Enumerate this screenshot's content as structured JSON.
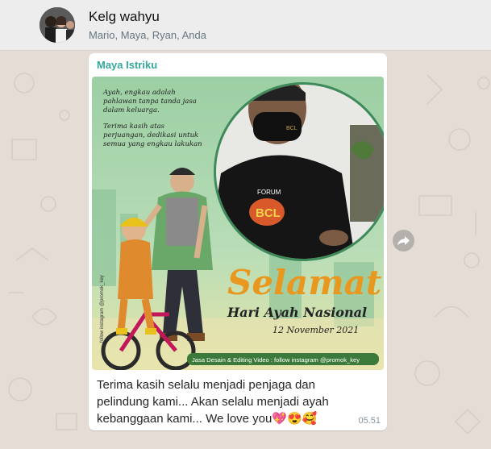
{
  "header": {
    "chat_name": "Kelg wahyu",
    "members": "Mario, Maya, Ryan, Anda"
  },
  "message": {
    "sender": "Maya Istriku",
    "caption": "Terima kasih selalu menjadi penjaga dan pelindung kami... Akan selalu menjadi ayah kebanggaan kami... We love you💖😍🥰",
    "time": "05.51",
    "poster": {
      "quote_line1": "Ayah, engkau adalah",
      "quote_line2": "pahlawan tanpa tanda jasa",
      "quote_line3": "dalam keluarga.",
      "quote_line4": "Terima kasih atas",
      "quote_line5": "perjuangan, dedikasi untuk",
      "quote_line6": "semua yang engkau lakukan",
      "mask_text": "BCL",
      "shirt_forum": "FORUM",
      "shirt_logo": "BCL",
      "title": "Selamat",
      "subtitle": "Hari Ayah Nasional",
      "date": "12 November 2021",
      "credit": "Jasa Desain & Editing Video : follow instagram @promok_key",
      "side_credit": "follow instagram @promok_key"
    }
  },
  "colors": {
    "sender": "#35a89c",
    "poster_bg": "#a8d4ad",
    "title_orange": "#e8981e",
    "header_bg": "#ededed",
    "chat_bg": "#e5ddd5"
  }
}
